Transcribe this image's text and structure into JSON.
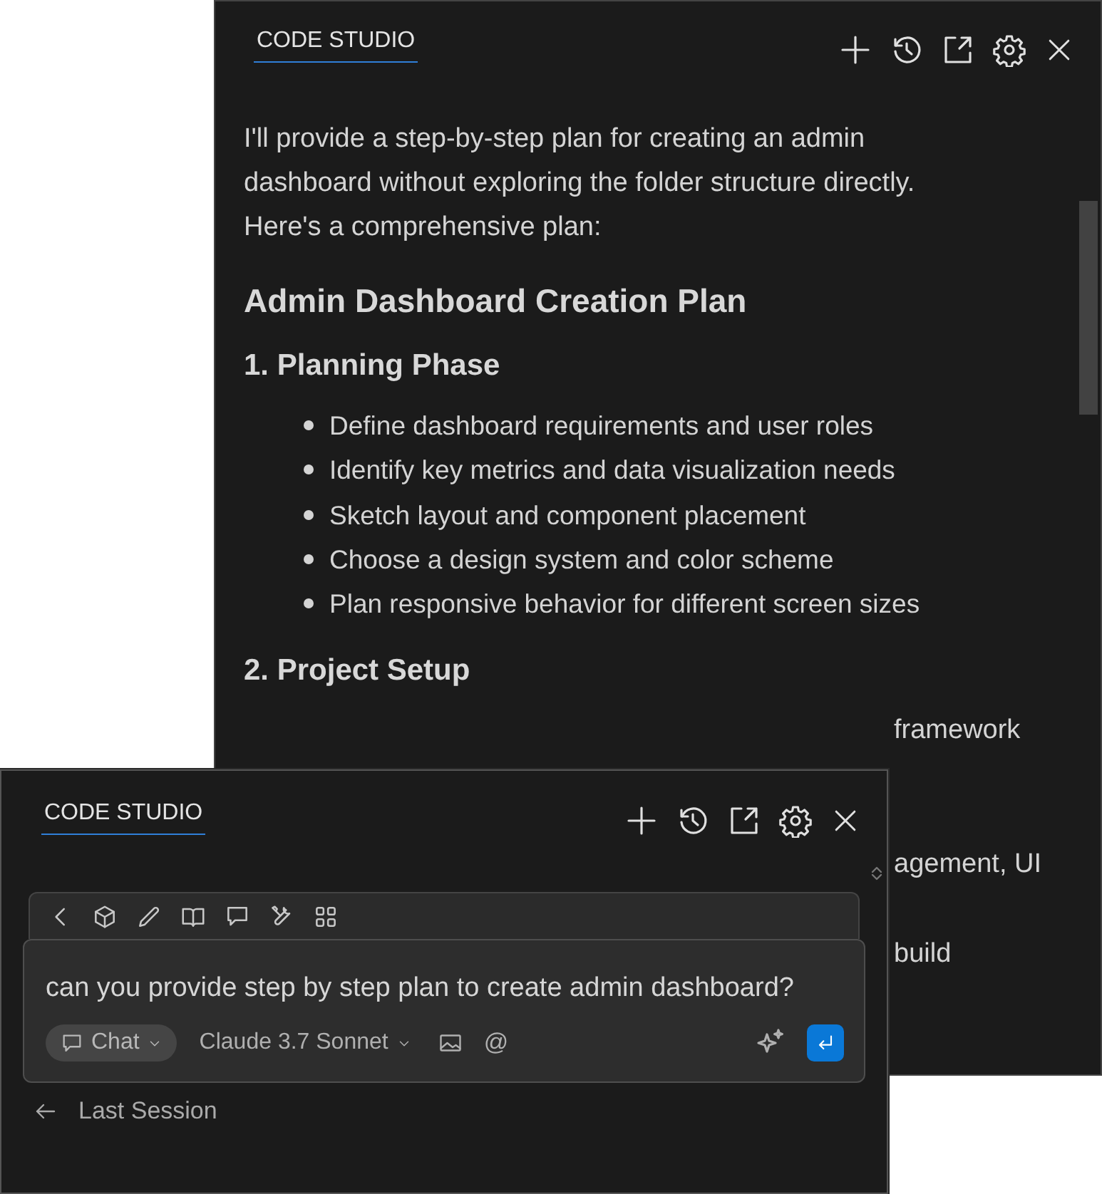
{
  "back_panel": {
    "tab": {
      "label": "CODE STUDIO",
      "selected": true
    },
    "message": {
      "intro": "I'll provide a step-by-step plan for creating an admin dashboard without exploring the folder structure directly. Here's a comprehensive plan:",
      "title": "Admin Dashboard Creation Plan",
      "sections": [
        {
          "heading": "1. Planning Phase",
          "items": [
            "Define dashboard requirements and user roles",
            "Identify key metrics and data visualization needs",
            "Sketch layout and component placement",
            "Choose a design system and color scheme",
            "Plan responsive behavior for different screen sizes"
          ]
        },
        {
          "heading": "2. Project Setup",
          "fragments": [
            "framework",
            "agement, UI",
            "build"
          ]
        }
      ]
    }
  },
  "front_panel": {
    "tab": {
      "label": "CODE STUDIO",
      "selected": true
    },
    "input": {
      "value": "can you provide step by step plan to create admin dashboard?"
    },
    "mode_button": "Chat",
    "model_picker": "Claude 3.7 Sonnet",
    "mention_symbol": "@",
    "back_link": "Last Session"
  }
}
